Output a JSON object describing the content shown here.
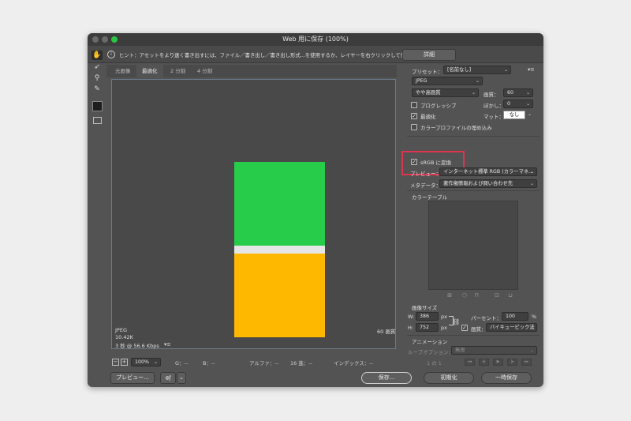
{
  "window": {
    "title": "Web 用に保存 (100%)"
  },
  "hint": {
    "icon": "info-icon",
    "text": "ヒント：アセットをより速く書き出すには、ファイル／書き出し／書き出し形式...を使用するか、レイヤーを右クリックして使用。"
  },
  "details_label": "詳細",
  "tools": [
    "hand-icon",
    "slice-select-icon",
    "zoom-icon",
    "eyedropper-icon"
  ],
  "tabs": [
    "元画像",
    "最適化",
    "2 分割",
    "4 分割"
  ],
  "image_colors": {
    "top": "#27cc4a",
    "gap": "#e6e6e6",
    "bottom": "#ffb800"
  },
  "image_info": {
    "format": "JPEG",
    "size": "10.42K",
    "speed": "3 秒 @ 56.6 Kbps",
    "menu": "▾≡",
    "quality": "60 画質"
  },
  "status": {
    "minus": "−",
    "plus": "+",
    "zoom": "100%",
    "g": "G：--",
    "b": "B：--",
    "alpha": "アルファ：--",
    "hex": "16 進：--",
    "index": "インデックス：--"
  },
  "preset": {
    "label": "プリセット：",
    "value": "[名前なし]",
    "menu": "▾≡"
  },
  "format": "JPEG",
  "quality_level": "やや高画質",
  "quality_label": "画質：",
  "quality_value": "60",
  "progressive": {
    "label": "プログレッシブ",
    "checked": false
  },
  "blur": {
    "label": "ぼかし：",
    "value": "0"
  },
  "optimized": {
    "label": "最適化",
    "checked": true
  },
  "matte": {
    "label": "マット：",
    "value": "なし"
  },
  "embed_profile": {
    "label": "カラープロファイルの埋め込み",
    "checked": false
  },
  "srgb": {
    "label": "sRGB に変換",
    "checked": true
  },
  "preview_row": {
    "label": "プレビュー：",
    "value": "インターネット標準 RGB (カラーマネ..."
  },
  "metadata": {
    "label": "メタデータ：",
    "value": "著作権情報および問い合わせ先"
  },
  "color_table_label": "カラーテーブル",
  "color_table_icons": [
    "map-icon",
    "cube-icon",
    "lock-icon",
    "new-color-icon",
    "trash-icon"
  ],
  "image_size": {
    "label": "画像サイズ",
    "w_label": "W:",
    "w_value": "386",
    "w_unit": "px",
    "h_label": "H:",
    "h_value": "752",
    "h_unit": "px",
    "percent_label": "パーセント：",
    "percent_value": "100",
    "percent_unit": "%",
    "resample_label": "画質：",
    "resample_value": "バイキュービック法"
  },
  "animation": {
    "label": "アニメーション",
    "loop_label": "ループオプション：",
    "loop_value": "無限",
    "frame": "1 の 1",
    "controls": [
      "◂◂",
      "◂|",
      "▶",
      "|▸",
      "▸▸"
    ]
  },
  "bottom": {
    "preview": "プレビュー...",
    "browser_icon": "browser-icon",
    "save": "保存...",
    "reset": "初期化",
    "remember": "一時保存"
  }
}
